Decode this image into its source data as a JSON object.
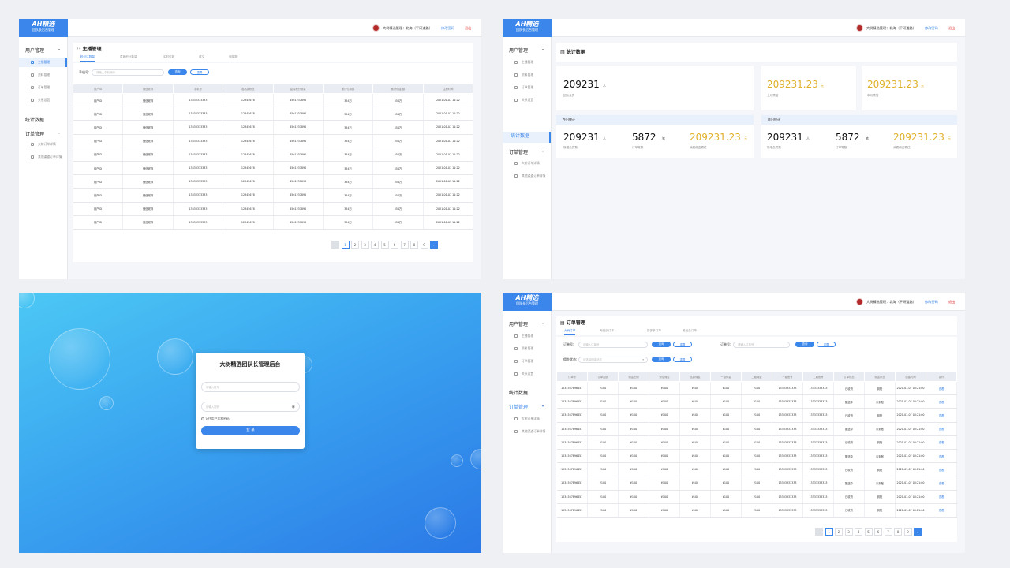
{
  "brand": {
    "logo": "AH精选",
    "sub": "团队长后台管理"
  },
  "topbar": {
    "user": "大树精选管理：北海（平研道路）",
    "change_pwd": "修改密码",
    "logout": "退出"
  },
  "sidebar": {
    "user_mgmt": "用户管理",
    "anchor_mgmt": "主播管理",
    "info_mgmt": "资料管理",
    "order_mgmt_item": "订单管理",
    "account_settings": "关系设置",
    "stats": "统计数据",
    "order_mgmt": "订单管理",
    "big_tree_orders": "大树订单详情",
    "third_party_orders": "其他渠道订单详情"
  },
  "anchor": {
    "title": "主播管理",
    "tabs": [
      "粉丝达数量",
      "直客积分数量",
      "实时付款",
      "成交",
      "佣奖数"
    ],
    "phone_label": "手机号:",
    "phone_placeholder": "请输入手机号码",
    "search": "查询",
    "reset": "重置",
    "columns": [
      "用户ID",
      "微信昵称",
      "手机号",
      "各品类粉丝",
      "直客积分数量",
      "累计付款额",
      "累计佣金 额",
      "注册时间"
    ],
    "rows": [
      [
        "用户ID",
        "微信昵称",
        "13333333333",
        "12345678",
        "4561237890",
        "354万",
        "354万",
        "2021-01-07 11:22"
      ],
      [
        "用户ID",
        "微信昵称",
        "13333333333",
        "12345678",
        "4561237890",
        "354万",
        "354万",
        "2021-01-07 11:22"
      ],
      [
        "用户ID",
        "微信昵称",
        "13333333333",
        "12345678",
        "4561237890",
        "354万",
        "354万",
        "2021-01-07 11:22"
      ],
      [
        "用户ID",
        "微信昵称",
        "13333333333",
        "12345678",
        "4561237890",
        "354万",
        "354万",
        "2021-01-07 11:22"
      ],
      [
        "用户ID",
        "微信昵称",
        "13333333333",
        "12345678",
        "4561237890",
        "354万",
        "354万",
        "2021-01-07 11:22"
      ],
      [
        "用户ID",
        "微信昵称",
        "13333333333",
        "12345678",
        "4561237890",
        "354万",
        "354万",
        "2021-01-07 11:22"
      ],
      [
        "用户ID",
        "微信昵称",
        "13333333333",
        "12345678",
        "4561237890",
        "354万",
        "354万",
        "2021-01-07 11:22"
      ],
      [
        "用户ID",
        "微信昵称",
        "13333333333",
        "12345678",
        "4561237890",
        "354万",
        "354万",
        "2021-01-07 11:22"
      ],
      [
        "用户ID",
        "微信昵称",
        "13333333333",
        "12345678",
        "4561237890",
        "354万",
        "354万",
        "2021-01-07 11:22"
      ],
      [
        "用户ID",
        "微信昵称",
        "13333333333",
        "12345678",
        "4561237890",
        "354万",
        "354万",
        "2021-01-07 11:22"
      ]
    ],
    "pages": [
      "1",
      "2",
      "3",
      "4",
      "5",
      "6",
      "7",
      "8",
      "9"
    ]
  },
  "stats": {
    "title": "统计数据",
    "total_members": "209231",
    "total_members_unit": "人",
    "total_members_label": "团队会员",
    "last_month": "209231.23",
    "last_month_unit": "元",
    "last_month_label": "上月预估",
    "this_month": "209231.23",
    "this_month_unit": "元",
    "this_month_label": "本月预估",
    "today_head": "今日统计",
    "yesterday_head": "昨日统计",
    "today": {
      "members": "209231",
      "members_unit": "人",
      "members_label": "新增会员数",
      "orders": "5872",
      "orders_unit": "笔",
      "orders_label": "订单笔数",
      "est": "209231.23",
      "est_unit": "元",
      "est_label": "消费佣金预估"
    },
    "yesterday": {
      "members": "209231",
      "members_unit": "人",
      "members_label": "新增会员数",
      "orders": "5872",
      "orders_unit": "笔",
      "orders_label": "订单笔数",
      "est": "209231.23",
      "est_unit": "元",
      "est_label": "消费佣金预估"
    }
  },
  "login": {
    "title": "大树精选团队长管理后台",
    "account_placeholder": "请输入账号",
    "password_placeholder": "请输入密码",
    "remember": "记住用户名和密码",
    "submit": "登 录"
  },
  "orders": {
    "title": "订单管理",
    "tabs": [
      "大树订单",
      "淘宝京订单",
      "拼多多订单",
      "唯品会订单"
    ],
    "order_label": "订单号:",
    "order_placeholder": "请输入订单号",
    "order_label2": "订单号:",
    "order_placeholder2": "请输入订单号",
    "status_label": "佣金状态:",
    "status_placeholder": "请选择佣金状态",
    "search": "查询",
    "reset": "重置",
    "columns": [
      "订单号",
      "订单金额",
      "佣金比例",
      "预估佣金",
      "结算佣金",
      "一级佣金",
      "二级佣金",
      "一级账号",
      "二级账号",
      "订单状态",
      "佣金状态",
      "创建时间",
      "操作"
    ],
    "rows": [
      [
        "1234567896451",
        "¥100",
        "¥100",
        "¥100",
        "¥100",
        "¥100",
        "¥100",
        "13333333333",
        "13333333333",
        "已收货",
        "到账",
        "2021-01-07 03:21:00",
        "查看"
      ],
      [
        "1234567896451",
        "¥100",
        "¥100",
        "¥100",
        "¥100",
        "¥100",
        "¥100",
        "13333333333",
        "13333333333",
        "配送中",
        "未到账",
        "2021-01-07 03:21:00",
        "查看"
      ],
      [
        "1234567896451",
        "¥100",
        "¥100",
        "¥100",
        "¥100",
        "¥100",
        "¥100",
        "13333333333",
        "13333333333",
        "已收货",
        "到账",
        "2021-01-07 03:21:00",
        "查看"
      ],
      [
        "1234567896451",
        "¥100",
        "¥100",
        "¥100",
        "¥100",
        "¥100",
        "¥100",
        "13333333333",
        "13333333333",
        "配送中",
        "未到账",
        "2021-01-07 03:21:00",
        "查看"
      ],
      [
        "1234567896451",
        "¥100",
        "¥100",
        "¥100",
        "¥100",
        "¥100",
        "¥100",
        "13333333333",
        "13333333333",
        "已收货",
        "到账",
        "2021-01-07 03:21:00",
        "查看"
      ],
      [
        "1234567896451",
        "¥100",
        "¥100",
        "¥100",
        "¥100",
        "¥100",
        "¥100",
        "13333333333",
        "13333333333",
        "配送中",
        "未到账",
        "2021-01-07 03:21:00",
        "查看"
      ],
      [
        "1234567896451",
        "¥100",
        "¥100",
        "¥100",
        "¥100",
        "¥100",
        "¥100",
        "13333333333",
        "13333333333",
        "已收货",
        "到账",
        "2021-01-07 03:21:00",
        "查看"
      ],
      [
        "1234567896451",
        "¥100",
        "¥100",
        "¥100",
        "¥100",
        "¥100",
        "¥100",
        "13333333333",
        "13333333333",
        "配送中",
        "未到账",
        "2021-01-07 03:21:00",
        "查看"
      ],
      [
        "1234567896451",
        "¥100",
        "¥100",
        "¥100",
        "¥100",
        "¥100",
        "¥100",
        "13333333333",
        "13333333333",
        "已收货",
        "到账",
        "2021-01-07 03:21:00",
        "查看"
      ],
      [
        "1234567896451",
        "¥100",
        "¥100",
        "¥100",
        "¥100",
        "¥100",
        "¥100",
        "13333333333",
        "13333333333",
        "已收货",
        "到账",
        "2021-01-07 03:21:00",
        "查看"
      ]
    ],
    "pages": [
      "1",
      "2",
      "3",
      "4",
      "5",
      "6",
      "7",
      "8",
      "9"
    ]
  },
  "colors": {
    "accent": "#3a86ea",
    "gold": "#e0b02a"
  }
}
